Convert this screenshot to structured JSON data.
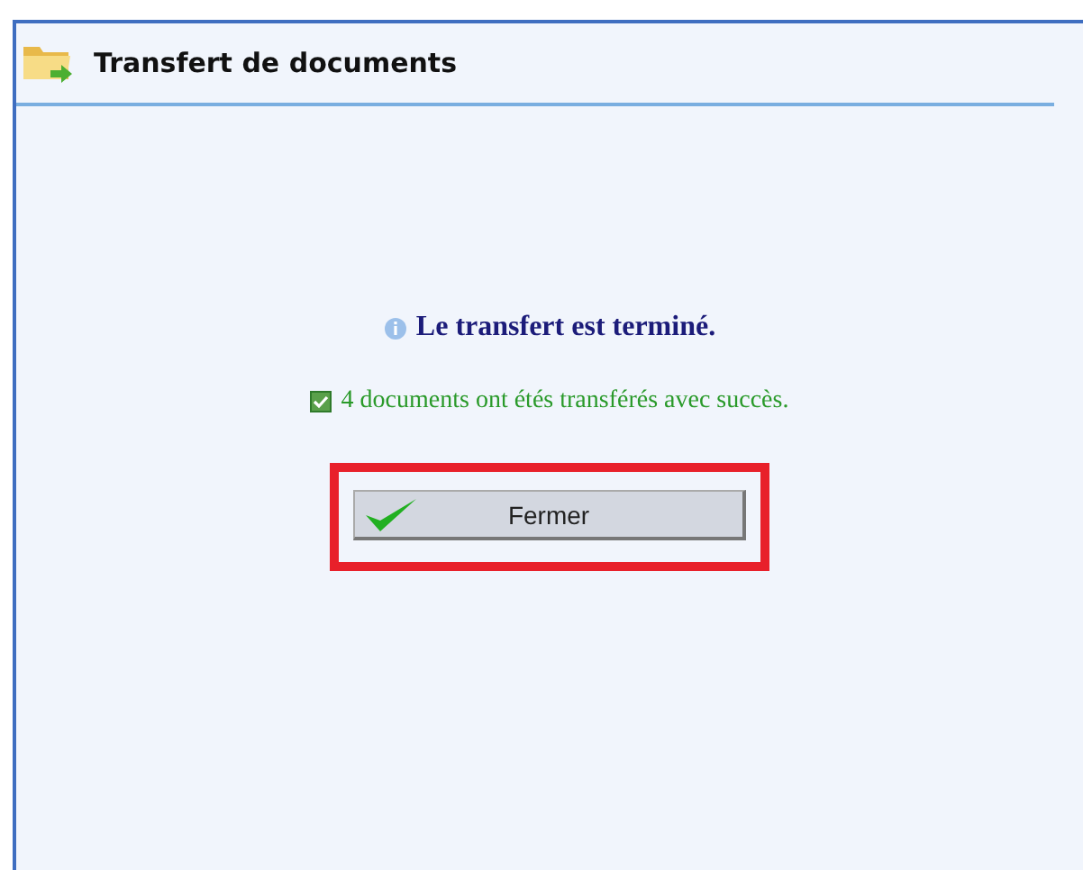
{
  "window": {
    "title": "Transfert de documents"
  },
  "message": {
    "info": "Le transfert est terminé.",
    "success": "4 documents ont étés transférés avec succès."
  },
  "button": {
    "label": "Fermer",
    "highlighted": true
  }
}
